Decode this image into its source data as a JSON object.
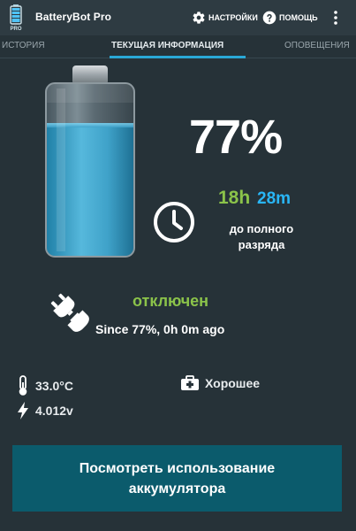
{
  "app": {
    "title": "BatteryBot Pro",
    "icon": "battery-bot-icon",
    "icon_badge": "PRO"
  },
  "actionbar": {
    "settings_label": "НАСТРОЙКИ",
    "settings_icon": "gear-icon",
    "help_label": "ПОМОЩЬ",
    "help_icon": "question-circle-icon",
    "overflow_icon": "more-vert-icon"
  },
  "tabs": [
    {
      "label": "ИСТОРИЯ",
      "selected": false
    },
    {
      "label": "ТЕКУЩАЯ ИНФОРМАЦИЯ",
      "selected": true
    },
    {
      "label": "ОПОВЕЩЕНИЯ",
      "selected": false
    }
  ],
  "battery": {
    "level_percent": 77,
    "percent_text": "77%",
    "hours_text": "18h",
    "minutes_text": "28m",
    "until_label": "до полного разряда"
  },
  "charge_status": {
    "status_text": "отключен",
    "since_text": "Since 77%, 0h 0m ago"
  },
  "stats": {
    "temperature": "33.0°C",
    "voltage": "4.012v",
    "health": "Хорошее"
  },
  "usage_button_label": "Посмотреть использование аккумулятора",
  "colors": {
    "background": "#263238",
    "actionbar": "#2e3b42",
    "accent_green": "#8bc34a",
    "accent_blue": "#29b6f6",
    "tab_indicator": "#2aa8d6",
    "button": "#0b5b6c"
  }
}
